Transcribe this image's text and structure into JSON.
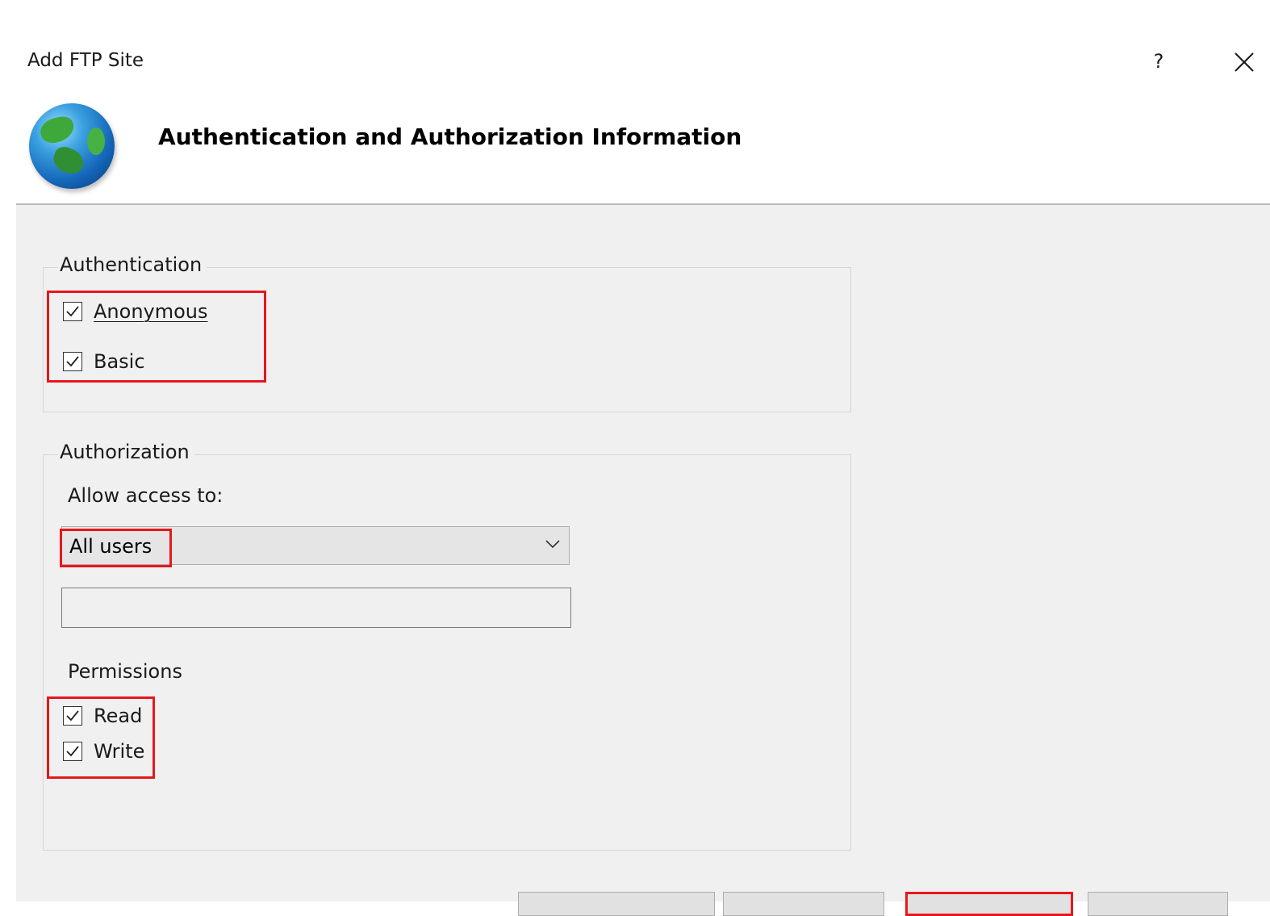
{
  "window": {
    "title": "Add FTP Site",
    "help_label": "?",
    "close_label": "✕"
  },
  "header": {
    "title": "Authentication and Authorization Information",
    "icon": "globe-icon"
  },
  "authentication": {
    "legend": "Authentication",
    "options": [
      {
        "label": "Anonymous",
        "checked": true
      },
      {
        "label": "Basic",
        "checked": true
      }
    ]
  },
  "authorization": {
    "legend": "Authorization",
    "allow_access_label": "Allow access to:",
    "allow_access_value": "All users",
    "user_input_value": "",
    "permissions_label": "Permissions",
    "permissions": [
      {
        "label": "Read",
        "checked": true
      },
      {
        "label": "Write",
        "checked": true
      }
    ]
  },
  "colors": {
    "highlight": "#e8161c",
    "panel_bg": "#f0f0f0"
  }
}
